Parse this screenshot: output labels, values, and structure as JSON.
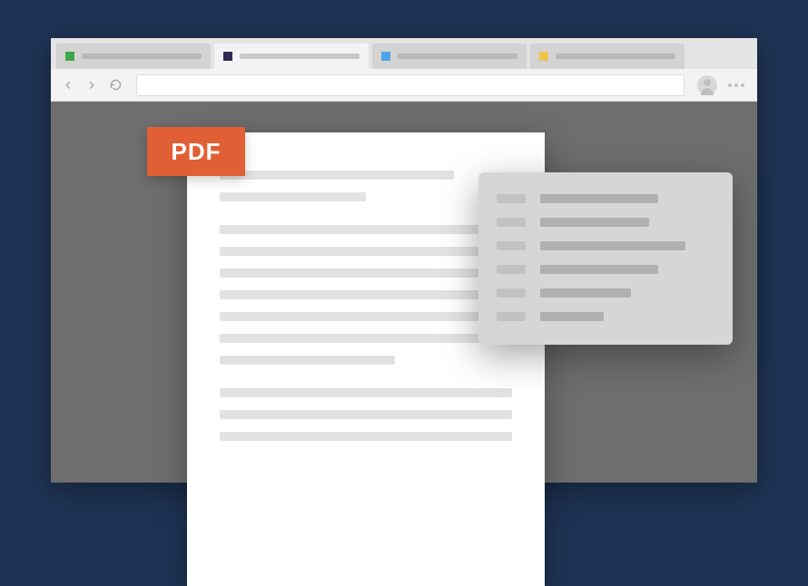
{
  "tabs": [
    {
      "iconColor": "#3fa84a",
      "active": false
    },
    {
      "iconColor": "#2d2a55",
      "active": true
    },
    {
      "iconColor": "#4fa3e8",
      "active": false
    },
    {
      "iconColor": "#f1c34a",
      "active": false
    }
  ],
  "pdfBadge": {
    "label": "PDF"
  },
  "document": {
    "lines": [
      {
        "width": "80%"
      },
      {
        "width": "50%"
      },
      {
        "gap": true
      },
      {
        "width": "100%"
      },
      {
        "width": "100%"
      },
      {
        "width": "100%"
      },
      {
        "width": "100%"
      },
      {
        "width": "100%"
      },
      {
        "width": "100%"
      },
      {
        "width": "60%"
      },
      {
        "gap": true
      },
      {
        "width": "100%"
      },
      {
        "width": "100%"
      },
      {
        "width": "100%"
      }
    ]
  },
  "contextMenu": {
    "items": [
      {
        "textWidth": "130px"
      },
      {
        "textWidth": "120px"
      },
      {
        "textWidth": "160px"
      },
      {
        "textWidth": "130px"
      },
      {
        "textWidth": "100px"
      },
      {
        "textWidth": "70px"
      }
    ]
  }
}
